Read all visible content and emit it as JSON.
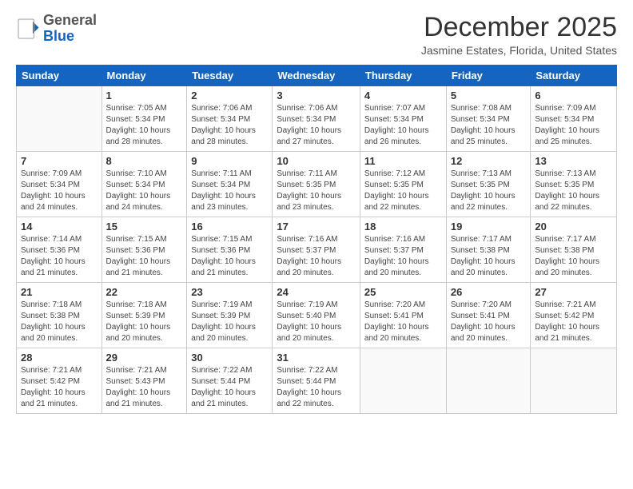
{
  "header": {
    "logo_general": "General",
    "logo_blue": "Blue",
    "month_title": "December 2025",
    "location": "Jasmine Estates, Florida, United States"
  },
  "days_of_week": [
    "Sunday",
    "Monday",
    "Tuesday",
    "Wednesday",
    "Thursday",
    "Friday",
    "Saturday"
  ],
  "weeks": [
    [
      {
        "num": "",
        "info": ""
      },
      {
        "num": "1",
        "info": "Sunrise: 7:05 AM\nSunset: 5:34 PM\nDaylight: 10 hours\nand 28 minutes."
      },
      {
        "num": "2",
        "info": "Sunrise: 7:06 AM\nSunset: 5:34 PM\nDaylight: 10 hours\nand 28 minutes."
      },
      {
        "num": "3",
        "info": "Sunrise: 7:06 AM\nSunset: 5:34 PM\nDaylight: 10 hours\nand 27 minutes."
      },
      {
        "num": "4",
        "info": "Sunrise: 7:07 AM\nSunset: 5:34 PM\nDaylight: 10 hours\nand 26 minutes."
      },
      {
        "num": "5",
        "info": "Sunrise: 7:08 AM\nSunset: 5:34 PM\nDaylight: 10 hours\nand 25 minutes."
      },
      {
        "num": "6",
        "info": "Sunrise: 7:09 AM\nSunset: 5:34 PM\nDaylight: 10 hours\nand 25 minutes."
      }
    ],
    [
      {
        "num": "7",
        "info": "Sunrise: 7:09 AM\nSunset: 5:34 PM\nDaylight: 10 hours\nand 24 minutes."
      },
      {
        "num": "8",
        "info": "Sunrise: 7:10 AM\nSunset: 5:34 PM\nDaylight: 10 hours\nand 24 minutes."
      },
      {
        "num": "9",
        "info": "Sunrise: 7:11 AM\nSunset: 5:34 PM\nDaylight: 10 hours\nand 23 minutes."
      },
      {
        "num": "10",
        "info": "Sunrise: 7:11 AM\nSunset: 5:35 PM\nDaylight: 10 hours\nand 23 minutes."
      },
      {
        "num": "11",
        "info": "Sunrise: 7:12 AM\nSunset: 5:35 PM\nDaylight: 10 hours\nand 22 minutes."
      },
      {
        "num": "12",
        "info": "Sunrise: 7:13 AM\nSunset: 5:35 PM\nDaylight: 10 hours\nand 22 minutes."
      },
      {
        "num": "13",
        "info": "Sunrise: 7:13 AM\nSunset: 5:35 PM\nDaylight: 10 hours\nand 22 minutes."
      }
    ],
    [
      {
        "num": "14",
        "info": "Sunrise: 7:14 AM\nSunset: 5:36 PM\nDaylight: 10 hours\nand 21 minutes."
      },
      {
        "num": "15",
        "info": "Sunrise: 7:15 AM\nSunset: 5:36 PM\nDaylight: 10 hours\nand 21 minutes."
      },
      {
        "num": "16",
        "info": "Sunrise: 7:15 AM\nSunset: 5:36 PM\nDaylight: 10 hours\nand 21 minutes."
      },
      {
        "num": "17",
        "info": "Sunrise: 7:16 AM\nSunset: 5:37 PM\nDaylight: 10 hours\nand 20 minutes."
      },
      {
        "num": "18",
        "info": "Sunrise: 7:16 AM\nSunset: 5:37 PM\nDaylight: 10 hours\nand 20 minutes."
      },
      {
        "num": "19",
        "info": "Sunrise: 7:17 AM\nSunset: 5:38 PM\nDaylight: 10 hours\nand 20 minutes."
      },
      {
        "num": "20",
        "info": "Sunrise: 7:17 AM\nSunset: 5:38 PM\nDaylight: 10 hours\nand 20 minutes."
      }
    ],
    [
      {
        "num": "21",
        "info": "Sunrise: 7:18 AM\nSunset: 5:38 PM\nDaylight: 10 hours\nand 20 minutes."
      },
      {
        "num": "22",
        "info": "Sunrise: 7:18 AM\nSunset: 5:39 PM\nDaylight: 10 hours\nand 20 minutes."
      },
      {
        "num": "23",
        "info": "Sunrise: 7:19 AM\nSunset: 5:39 PM\nDaylight: 10 hours\nand 20 minutes."
      },
      {
        "num": "24",
        "info": "Sunrise: 7:19 AM\nSunset: 5:40 PM\nDaylight: 10 hours\nand 20 minutes."
      },
      {
        "num": "25",
        "info": "Sunrise: 7:20 AM\nSunset: 5:41 PM\nDaylight: 10 hours\nand 20 minutes."
      },
      {
        "num": "26",
        "info": "Sunrise: 7:20 AM\nSunset: 5:41 PM\nDaylight: 10 hours\nand 20 minutes."
      },
      {
        "num": "27",
        "info": "Sunrise: 7:21 AM\nSunset: 5:42 PM\nDaylight: 10 hours\nand 21 minutes."
      }
    ],
    [
      {
        "num": "28",
        "info": "Sunrise: 7:21 AM\nSunset: 5:42 PM\nDaylight: 10 hours\nand 21 minutes."
      },
      {
        "num": "29",
        "info": "Sunrise: 7:21 AM\nSunset: 5:43 PM\nDaylight: 10 hours\nand 21 minutes."
      },
      {
        "num": "30",
        "info": "Sunrise: 7:22 AM\nSunset: 5:44 PM\nDaylight: 10 hours\nand 21 minutes."
      },
      {
        "num": "31",
        "info": "Sunrise: 7:22 AM\nSunset: 5:44 PM\nDaylight: 10 hours\nand 22 minutes."
      },
      {
        "num": "",
        "info": ""
      },
      {
        "num": "",
        "info": ""
      },
      {
        "num": "",
        "info": ""
      }
    ]
  ]
}
